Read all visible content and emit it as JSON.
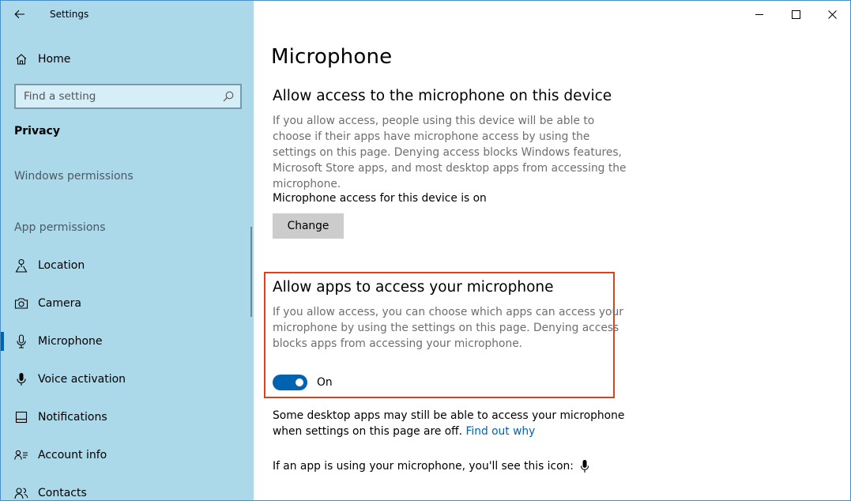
{
  "window": {
    "app_title": "Settings",
    "accent_color": "#0063b1",
    "sidebar_color": "#abd9ea",
    "highlight_color": "#d9421c"
  },
  "sidebar": {
    "home_label": "Home",
    "search_placeholder": "Find a setting",
    "section_title": "Privacy",
    "windows_permissions_heading": "Windows permissions",
    "app_permissions_heading": "App permissions",
    "items": [
      {
        "label": "Location",
        "icon": "location-icon"
      },
      {
        "label": "Camera",
        "icon": "camera-icon"
      },
      {
        "label": "Microphone",
        "icon": "microphone-icon",
        "active": true
      },
      {
        "label": "Voice activation",
        "icon": "voice-activation-icon"
      },
      {
        "label": "Notifications",
        "icon": "notifications-icon"
      },
      {
        "label": "Account info",
        "icon": "account-info-icon"
      },
      {
        "label": "Contacts",
        "icon": "contacts-icon"
      }
    ]
  },
  "main": {
    "page_title": "Microphone",
    "device_section": {
      "heading": "Allow access to the microphone on this device",
      "description": "If you allow access, people using this device will be able to choose if their apps have microphone access by using the settings on this page. Denying access blocks Windows features, Microsoft Store apps, and most desktop apps from accessing the microphone.",
      "status": "Microphone access for this device is on",
      "change_button": "Change"
    },
    "apps_section": {
      "heading": "Allow apps to access your microphone",
      "description": "If you allow access, you can choose which apps can access your microphone by using the settings on this page. Denying access blocks apps from accessing your microphone.",
      "toggle_state": "On",
      "toggle_on": true
    },
    "desktop_note": {
      "text": "Some desktop apps may still be able to access your microphone when settings on this page are off.",
      "link": "Find out why"
    },
    "icon_note": "If an app is using your microphone, you'll see this icon:"
  }
}
